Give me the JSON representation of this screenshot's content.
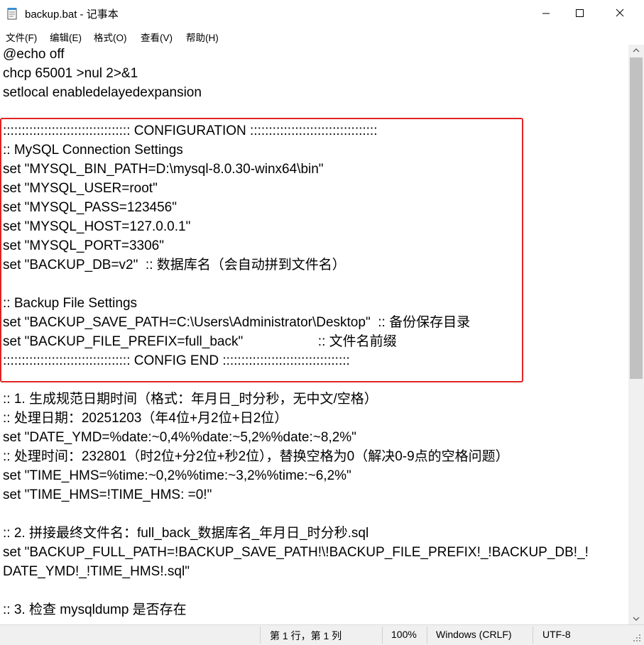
{
  "window": {
    "title": "backup.bat - 记事本",
    "icon": "notepad-icon",
    "controls": [
      "minimize-icon",
      "maximize-icon",
      "close-icon"
    ]
  },
  "menu": {
    "items": [
      "文件(F)",
      "编辑(E)",
      "格式(O)",
      "查看(V)",
      "帮助(H)"
    ]
  },
  "editor": {
    "highlight_color": "#e02424",
    "lines": [
      "@echo off",
      "chcp 65001 >nul 2>&1",
      "setlocal enabledelayedexpansion",
      "",
      ":::::::::::::::::::::::::::::::::: CONFIGURATION ::::::::::::::::::::::::::::::::::",
      ":: MySQL Connection Settings",
      "set \"MYSQL_BIN_PATH=D:\\mysql-8.0.30-winx64\\bin\"",
      "set \"MYSQL_USER=root\"",
      "set \"MYSQL_PASS=123456\"",
      "set \"MYSQL_HOST=127.0.0.1\"",
      "set \"MYSQL_PORT=3306\"",
      "set \"BACKUP_DB=v2\"  :: 数据库名（会自动拼到文件名）",
      "",
      ":: Backup File Settings",
      "set \"BACKUP_SAVE_PATH=C:\\Users\\Administrator\\Desktop\"  :: 备份保存目录",
      "set \"BACKUP_FILE_PREFIX=full_back\"                    :: 文件名前缀",
      ":::::::::::::::::::::::::::::::::: CONFIG END ::::::::::::::::::::::::::::::::::",
      "",
      ":: 1. 生成规范日期时间（格式：年月日_时分秒，无中文/空格）",
      ":: 处理日期：20251203（年4位+月2位+日2位）",
      "set \"DATE_YMD=%date:~0,4%%date:~5,2%%date:~8,2%\"",
      ":: 处理时间：232801（时2位+分2位+秒2位），替换空格为0（解决0-9点的空格问题）",
      "set \"TIME_HMS=%time:~0,2%%time:~3,2%%time:~6,2%\"",
      "set \"TIME_HMS=!TIME_HMS: =0!\"",
      "",
      ":: 2. 拼接最终文件名：full_back_数据库名_年月日_时分秒.sql",
      "set \"BACKUP_FULL_PATH=!BACKUP_SAVE_PATH!\\!BACKUP_FILE_PREFIX!_!BACKUP_DB!_!",
      "DATE_YMD!_!TIME_HMS!.sql\"",
      "",
      ":: 3. 检查 mysqldump 是否存在"
    ]
  },
  "status": {
    "position": "第 1 行，第 1 列",
    "zoom": "100%",
    "line_ending": "Windows (CRLF)",
    "encoding": "UTF-8"
  }
}
